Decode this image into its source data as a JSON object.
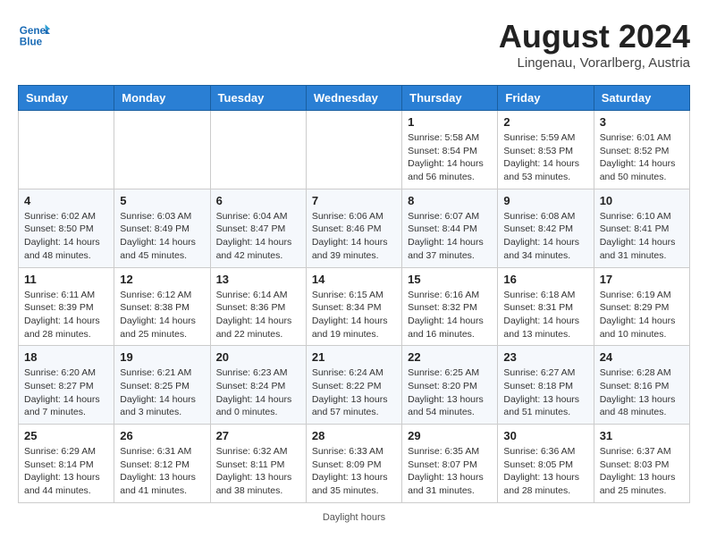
{
  "header": {
    "logo_line1": "General",
    "logo_line2": "Blue",
    "month_year": "August 2024",
    "location": "Lingenau, Vorarlberg, Austria"
  },
  "days_of_week": [
    "Sunday",
    "Monday",
    "Tuesday",
    "Wednesday",
    "Thursday",
    "Friday",
    "Saturday"
  ],
  "weeks": [
    [
      {
        "day": "",
        "info": ""
      },
      {
        "day": "",
        "info": ""
      },
      {
        "day": "",
        "info": ""
      },
      {
        "day": "",
        "info": ""
      },
      {
        "day": "1",
        "info": "Sunrise: 5:58 AM\nSunset: 8:54 PM\nDaylight: 14 hours\nand 56 minutes."
      },
      {
        "day": "2",
        "info": "Sunrise: 5:59 AM\nSunset: 8:53 PM\nDaylight: 14 hours\nand 53 minutes."
      },
      {
        "day": "3",
        "info": "Sunrise: 6:01 AM\nSunset: 8:52 PM\nDaylight: 14 hours\nand 50 minutes."
      }
    ],
    [
      {
        "day": "4",
        "info": "Sunrise: 6:02 AM\nSunset: 8:50 PM\nDaylight: 14 hours\nand 48 minutes."
      },
      {
        "day": "5",
        "info": "Sunrise: 6:03 AM\nSunset: 8:49 PM\nDaylight: 14 hours\nand 45 minutes."
      },
      {
        "day": "6",
        "info": "Sunrise: 6:04 AM\nSunset: 8:47 PM\nDaylight: 14 hours\nand 42 minutes."
      },
      {
        "day": "7",
        "info": "Sunrise: 6:06 AM\nSunset: 8:46 PM\nDaylight: 14 hours\nand 39 minutes."
      },
      {
        "day": "8",
        "info": "Sunrise: 6:07 AM\nSunset: 8:44 PM\nDaylight: 14 hours\nand 37 minutes."
      },
      {
        "day": "9",
        "info": "Sunrise: 6:08 AM\nSunset: 8:42 PM\nDaylight: 14 hours\nand 34 minutes."
      },
      {
        "day": "10",
        "info": "Sunrise: 6:10 AM\nSunset: 8:41 PM\nDaylight: 14 hours\nand 31 minutes."
      }
    ],
    [
      {
        "day": "11",
        "info": "Sunrise: 6:11 AM\nSunset: 8:39 PM\nDaylight: 14 hours\nand 28 minutes."
      },
      {
        "day": "12",
        "info": "Sunrise: 6:12 AM\nSunset: 8:38 PM\nDaylight: 14 hours\nand 25 minutes."
      },
      {
        "day": "13",
        "info": "Sunrise: 6:14 AM\nSunset: 8:36 PM\nDaylight: 14 hours\nand 22 minutes."
      },
      {
        "day": "14",
        "info": "Sunrise: 6:15 AM\nSunset: 8:34 PM\nDaylight: 14 hours\nand 19 minutes."
      },
      {
        "day": "15",
        "info": "Sunrise: 6:16 AM\nSunset: 8:32 PM\nDaylight: 14 hours\nand 16 minutes."
      },
      {
        "day": "16",
        "info": "Sunrise: 6:18 AM\nSunset: 8:31 PM\nDaylight: 14 hours\nand 13 minutes."
      },
      {
        "day": "17",
        "info": "Sunrise: 6:19 AM\nSunset: 8:29 PM\nDaylight: 14 hours\nand 10 minutes."
      }
    ],
    [
      {
        "day": "18",
        "info": "Sunrise: 6:20 AM\nSunset: 8:27 PM\nDaylight: 14 hours\nand 7 minutes."
      },
      {
        "day": "19",
        "info": "Sunrise: 6:21 AM\nSunset: 8:25 PM\nDaylight: 14 hours\nand 3 minutes."
      },
      {
        "day": "20",
        "info": "Sunrise: 6:23 AM\nSunset: 8:24 PM\nDaylight: 14 hours\nand 0 minutes."
      },
      {
        "day": "21",
        "info": "Sunrise: 6:24 AM\nSunset: 8:22 PM\nDaylight: 13 hours\nand 57 minutes."
      },
      {
        "day": "22",
        "info": "Sunrise: 6:25 AM\nSunset: 8:20 PM\nDaylight: 13 hours\nand 54 minutes."
      },
      {
        "day": "23",
        "info": "Sunrise: 6:27 AM\nSunset: 8:18 PM\nDaylight: 13 hours\nand 51 minutes."
      },
      {
        "day": "24",
        "info": "Sunrise: 6:28 AM\nSunset: 8:16 PM\nDaylight: 13 hours\nand 48 minutes."
      }
    ],
    [
      {
        "day": "25",
        "info": "Sunrise: 6:29 AM\nSunset: 8:14 PM\nDaylight: 13 hours\nand 44 minutes."
      },
      {
        "day": "26",
        "info": "Sunrise: 6:31 AM\nSunset: 8:12 PM\nDaylight: 13 hours\nand 41 minutes."
      },
      {
        "day": "27",
        "info": "Sunrise: 6:32 AM\nSunset: 8:11 PM\nDaylight: 13 hours\nand 38 minutes."
      },
      {
        "day": "28",
        "info": "Sunrise: 6:33 AM\nSunset: 8:09 PM\nDaylight: 13 hours\nand 35 minutes."
      },
      {
        "day": "29",
        "info": "Sunrise: 6:35 AM\nSunset: 8:07 PM\nDaylight: 13 hours\nand 31 minutes."
      },
      {
        "day": "30",
        "info": "Sunrise: 6:36 AM\nSunset: 8:05 PM\nDaylight: 13 hours\nand 28 minutes."
      },
      {
        "day": "31",
        "info": "Sunrise: 6:37 AM\nSunset: 8:03 PM\nDaylight: 13 hours\nand 25 minutes."
      }
    ]
  ],
  "footer": "Daylight hours"
}
